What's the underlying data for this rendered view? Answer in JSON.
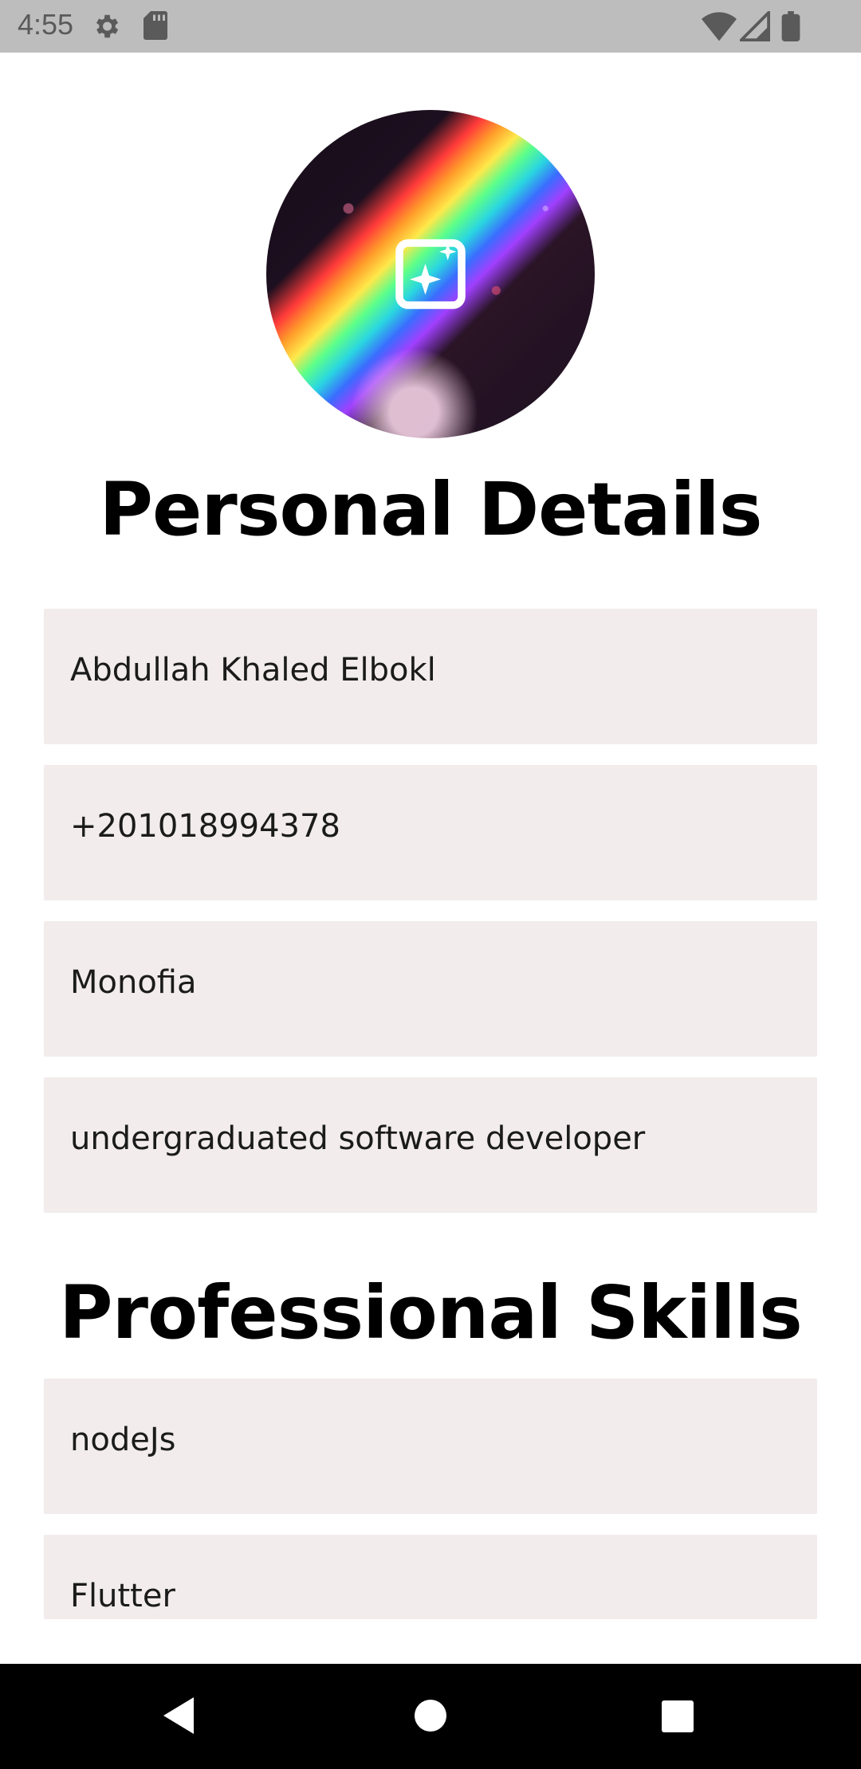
{
  "status_bar": {
    "time": "4:55",
    "icons": [
      "settings-gear-icon",
      "sd-card-icon",
      "wifi-icon",
      "cell-signal-icon",
      "battery-icon"
    ]
  },
  "profile": {
    "avatar_icon": "add-photo-sparkle-icon"
  },
  "personal_details": {
    "title": "Personal Details",
    "fields": [
      {
        "value": "Abdullah Khaled Elbokl"
      },
      {
        "value": "+201018994378"
      },
      {
        "value": "Monofia"
      },
      {
        "value": "undergraduated software developer"
      }
    ]
  },
  "professional_skills": {
    "title": "Professional Skills",
    "items": [
      {
        "value": "nodeJs"
      },
      {
        "value": "Flutter"
      }
    ]
  },
  "nav_bar": {
    "buttons": [
      "back-icon",
      "home-icon",
      "recents-icon"
    ]
  },
  "colors": {
    "status_bar_bg": "#bdbdbd",
    "field_bg": "#f2ecec",
    "nav_bar_bg": "#000000"
  }
}
